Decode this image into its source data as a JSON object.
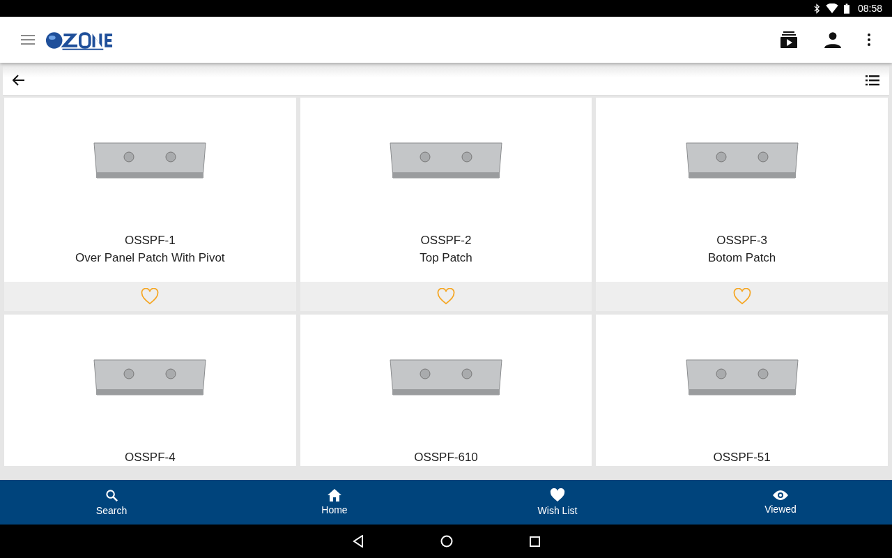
{
  "status_bar": {
    "time": "08:58"
  },
  "products": [
    {
      "code": "OSSPF-1",
      "name": "Over Panel Patch With Pivot",
      "wishlisted": false
    },
    {
      "code": "OSSPF-2",
      "name": "Top Patch",
      "wishlisted": false
    },
    {
      "code": "OSSPF-3",
      "name": "Botom Patch",
      "wishlisted": false
    },
    {
      "code": "OSSPF-4"
    },
    {
      "code": "OSSPF-610"
    },
    {
      "code": "OSSPF-51"
    }
  ],
  "bottom_nav": [
    {
      "kind": "search",
      "label": "Search"
    },
    {
      "kind": "home",
      "label": "Home"
    },
    {
      "kind": "wishlist",
      "label": "Wish List"
    },
    {
      "kind": "viewed",
      "label": "Viewed"
    }
  ]
}
